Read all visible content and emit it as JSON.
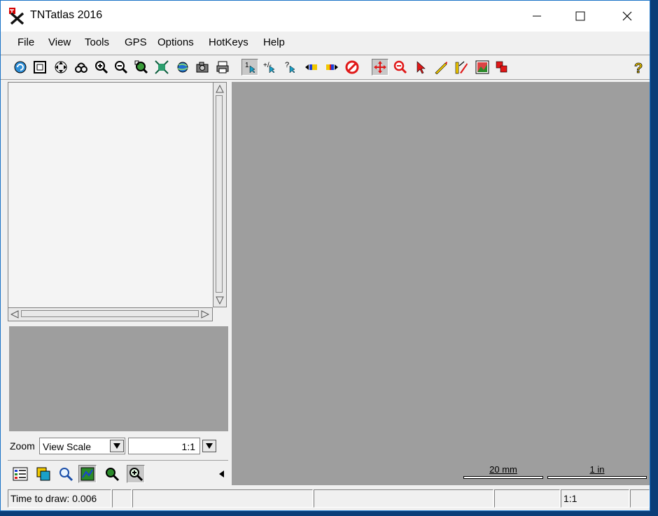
{
  "window": {
    "title": "TNTatlas 2016"
  },
  "menu": [
    "File",
    "View",
    "Tools",
    "GPS",
    "Options",
    "HotKeys",
    "Help"
  ],
  "toolbar": {
    "icons": [
      "redraw-icon",
      "full-view-icon",
      "pan-icon",
      "previous-view-icon",
      "zoom-in-icon",
      "zoom-out-icon",
      "zoom-box-icon",
      "zoom-fit-icon",
      "globe-icon",
      "camera-icon",
      "print-icon",
      "select-one-icon",
      "select-many-icon",
      "query-icon",
      "previous-element-icon",
      "next-element-icon",
      "clear-selection-icon",
      "move-icon",
      "zoom-tool-icon",
      "pointer-icon",
      "measure-icon",
      "sketch-icon",
      "image-icon",
      "layers-icon",
      "help-icon"
    ]
  },
  "zoom": {
    "label": "Zoom",
    "mode": "View Scale",
    "ratio": "1:1"
  },
  "scalebars": [
    {
      "label": "20 mm"
    },
    {
      "label": "1 in"
    }
  ],
  "status": {
    "time_to_draw": "Time to draw: 0.006",
    "scale": "1:1"
  },
  "colors": {
    "canvas": "#9e9e9e",
    "window_border": "#1a73c7"
  }
}
